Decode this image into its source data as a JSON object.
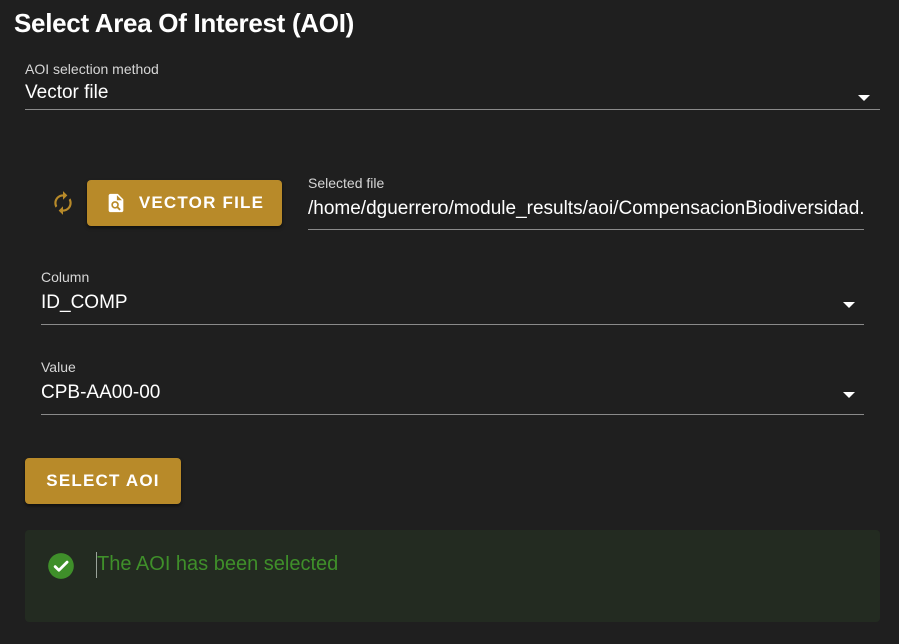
{
  "title": "Select Area Of Interest (AOI)",
  "aoi_method": {
    "label": "AOI selection method",
    "value": "Vector file"
  },
  "vector": {
    "button_label": "VECTOR FILE",
    "selected_file_label": "Selected file",
    "selected_file_value": "/home/dguerrero/module_results/aoi/CompensacionBiodiversidad.shp"
  },
  "column": {
    "label": "Column",
    "value": "ID_COMP"
  },
  "value_field": {
    "label": "Value",
    "value": "CPB-AA00-00"
  },
  "select_button_label": "SELECT AOI",
  "alert": {
    "message": "The AOI has been selected",
    "color": "#3f8f2a"
  },
  "colors": {
    "accent": "#b88a29",
    "background": "#1f1f1f",
    "success": "#3f8f2a"
  },
  "icons": [
    "refresh-icon",
    "file-search-icon",
    "dropdown-caret-icon",
    "check-circle-icon"
  ]
}
